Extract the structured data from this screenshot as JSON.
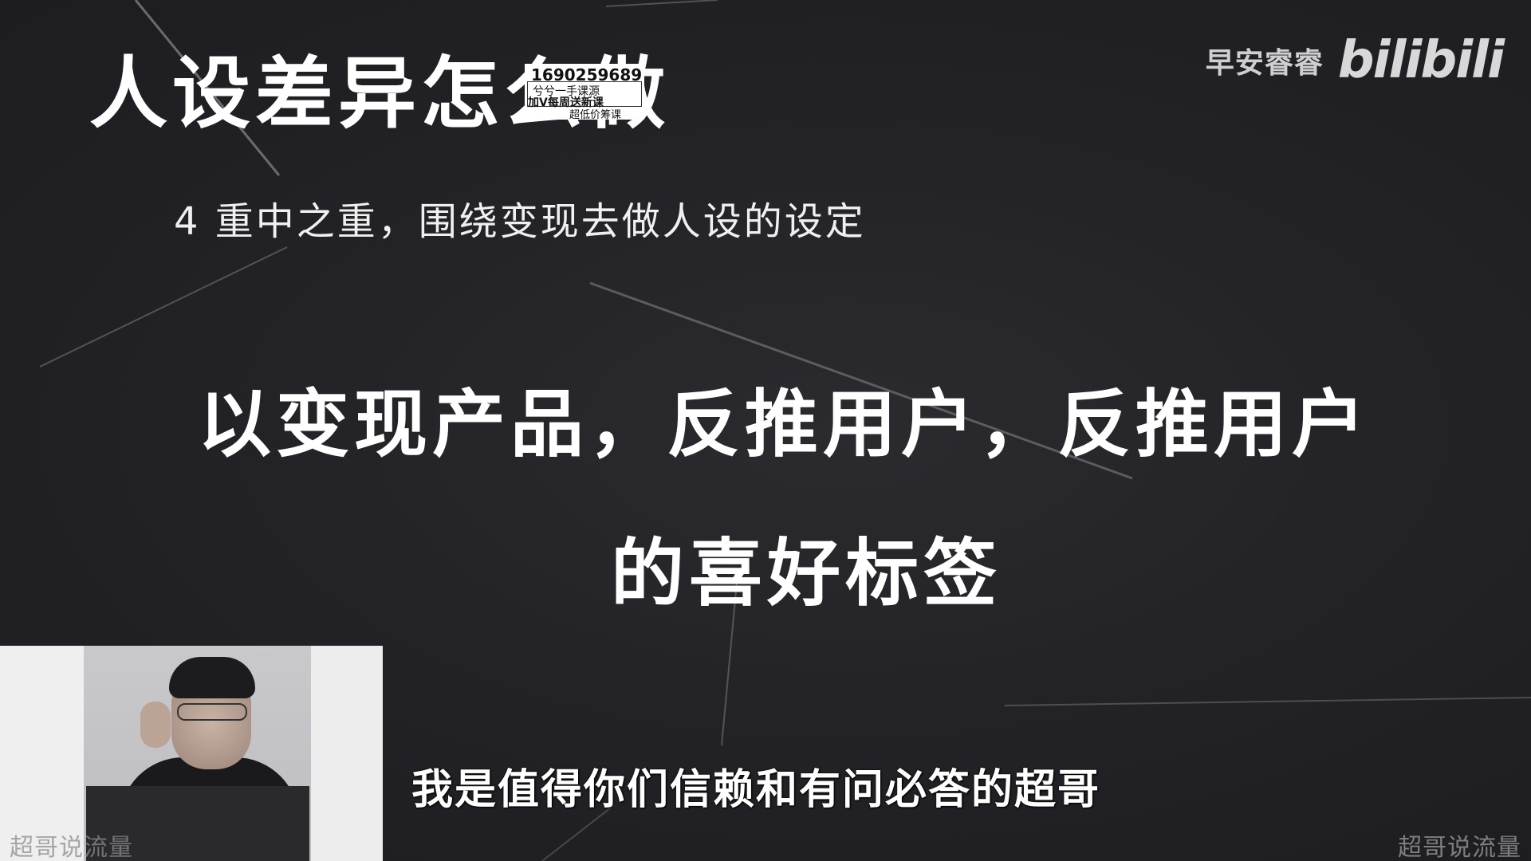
{
  "slide": {
    "title": "人设差异怎么做",
    "subpoint": "4 重中之重，围绕变现去做人设的设定",
    "main_line_1": "以变现产品，反推用户，反推用户",
    "main_line_2": "的喜好标签"
  },
  "stamp": {
    "number": "1690259689",
    "line1": "兮兮一手课源",
    "line2": "加V每周送新课",
    "line3": "超低价筹课"
  },
  "brand": {
    "channel_name": "早安睿睿",
    "platform_logo": "bilibili"
  },
  "subtitle": {
    "text": "我是值得你们信赖和有问必答的超哥"
  },
  "watermarks": {
    "left": "超哥说流量",
    "right": "超哥说流量"
  },
  "colors": {
    "background": "#232327",
    "text": "#ffffff",
    "watermark": "#8c8c8c"
  }
}
